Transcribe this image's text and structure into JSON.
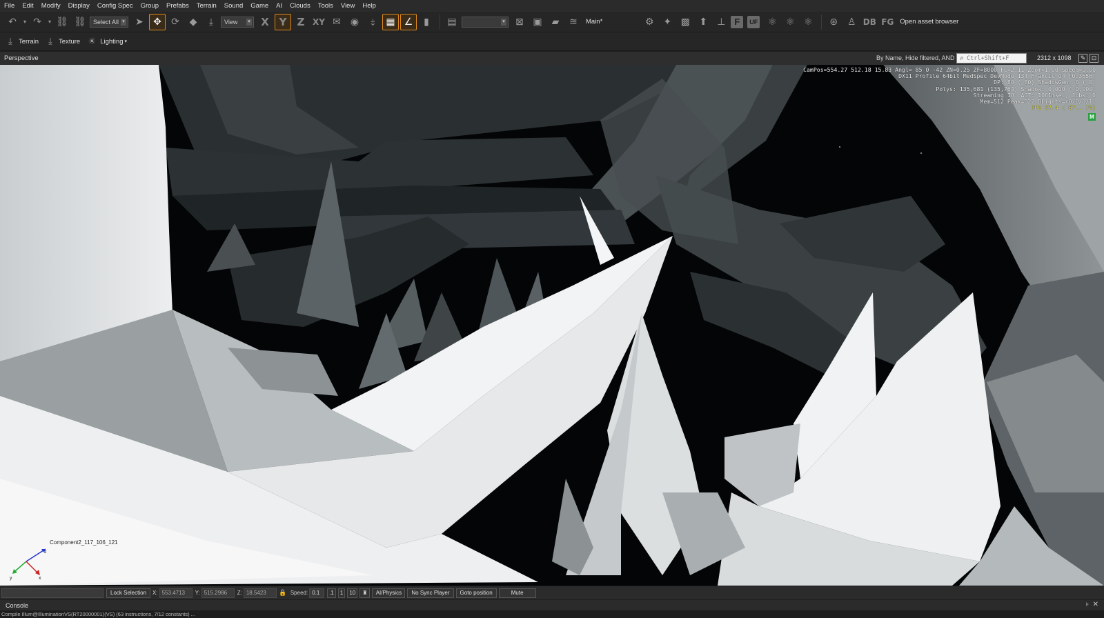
{
  "menu": [
    "File",
    "Edit",
    "Modify",
    "Display",
    "Config Spec",
    "Group",
    "Prefabs",
    "Terrain",
    "Sound",
    "Game",
    "AI",
    "Clouds",
    "Tools",
    "View",
    "Help"
  ],
  "toolbar": {
    "select_all": "Select All",
    "view_combo": "View",
    "axis_x": "X",
    "axis_y": "Y",
    "axis_z": "Z",
    "axis_xy": "XY",
    "layer_label": "Main*",
    "f_label": "F",
    "uf_label": "UF",
    "db_label": "DB",
    "fg_label": "FG",
    "open_asset_browser": "Open asset browser"
  },
  "toolbar2": {
    "terrain": "Terrain",
    "texture": "Texture",
    "lighting": "Lighting"
  },
  "viewport_header": {
    "title": "Perspective",
    "filter_text": "By Name, Hide filtered, AND",
    "search_placeholder": "Ctrl+Shift+F",
    "resolution": "2312 x 1098"
  },
  "overlay": {
    "lines": [
      "CamPos=554.27 512.18 15.83 Angl= 85  0 -42 ZN=0.25 ZF=8000 FC=2.11 Zoom=1.00 Speed=0.00",
      "DX11 Profile 64bit MedSpec DevMode 134 Francis 04 [0.3656]",
      "DP:   80 (  80) ShadowGen:   0 (  0)",
      "Polys: 135,681 (135,764) Shadow: 0,000 ( 0,000)",
      "Streaming IO: ACT: 1061msec, Jobs: 0",
      "Mem=512 Peak=522 DLights=(0/0/0/1)"
    ],
    "fps": "FPS  67.4 ( 67.. 70)",
    "badge": "M"
  },
  "viewport": {
    "object_label": "Component2_117_106_121"
  },
  "status": {
    "lock_selection": "Lock Selection",
    "x_label": "X:",
    "x_value": "553.4713",
    "y_label": "Y:",
    "y_value": "515.2986",
    "z_label": "Z:",
    "z_value": "18.5423",
    "speed_label": "Speed:",
    "speed_value": "0.1",
    "speed_presets": [
      ".1",
      "1",
      "10"
    ],
    "ai_physics": "AI/Physics",
    "no_sync_player": "No Sync Player",
    "goto_position": "Goto position",
    "mute": "Mute"
  },
  "console": {
    "title": "Console",
    "line": "Compile Illum@IlluminationVS(RT20000001)(VS) (63 instructions, 7/12 constants) ..."
  }
}
